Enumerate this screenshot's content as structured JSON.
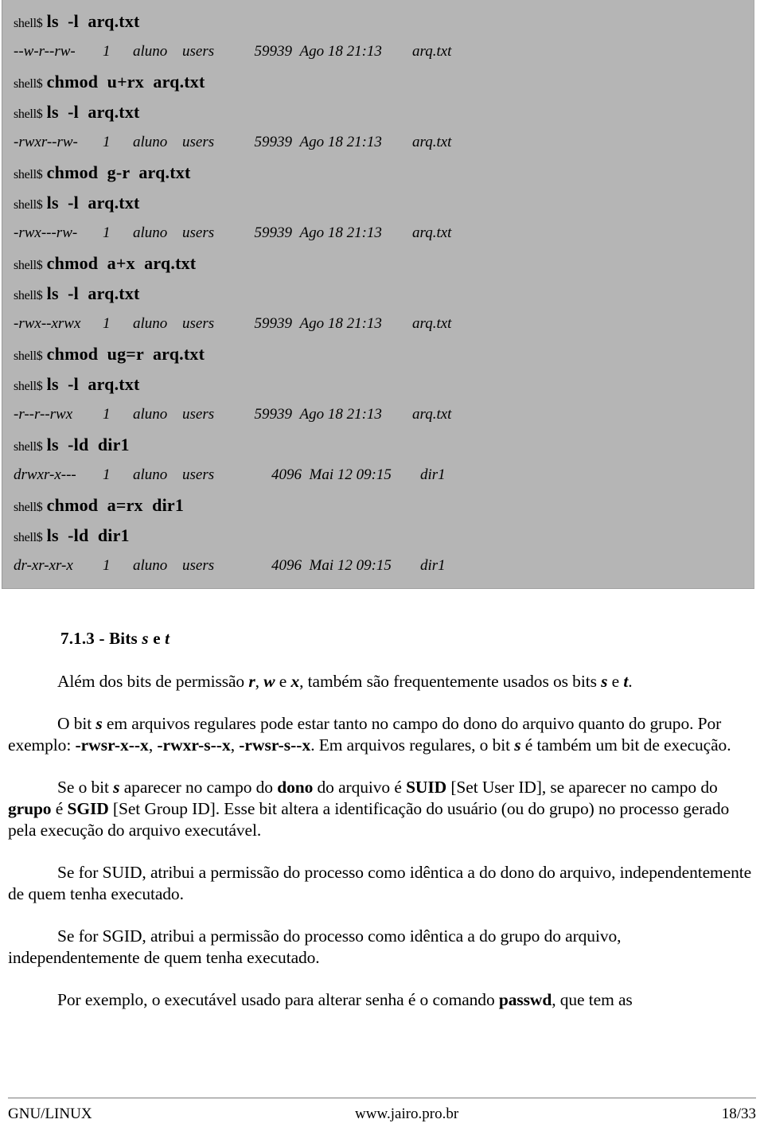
{
  "terminal": {
    "prompt": "shell$",
    "lines": [
      {
        "type": "command",
        "prompt": "shell$",
        "text": "ls  -l  arq.txt"
      },
      {
        "type": "listing",
        "kind": "file",
        "perm": "--w-r--rw-",
        "links": "1",
        "owner": "aluno",
        "group": "users",
        "size": "59939",
        "date": "Ago 18 21:13",
        "name": "arq.txt"
      },
      {
        "type": "command",
        "prompt": "shell$",
        "text": "chmod  u+rx  arq.txt"
      },
      {
        "type": "command",
        "prompt": "shell$",
        "text": "ls  -l  arq.txt"
      },
      {
        "type": "listing",
        "kind": "file",
        "perm": "-rwxr--rw-",
        "links": "1",
        "owner": "aluno",
        "group": "users",
        "size": "59939",
        "date": "Ago 18 21:13",
        "name": "arq.txt"
      },
      {
        "type": "command",
        "prompt": "shell$",
        "text": "chmod  g-r  arq.txt"
      },
      {
        "type": "command",
        "prompt": "shell$",
        "text": "ls  -l  arq.txt"
      },
      {
        "type": "listing",
        "kind": "file",
        "perm": "-rwx---rw-",
        "links": "1",
        "owner": "aluno",
        "group": "users",
        "size": "59939",
        "date": "Ago 18 21:13",
        "name": "arq.txt"
      },
      {
        "type": "command",
        "prompt": "shell$",
        "text": "chmod  a+x  arq.txt"
      },
      {
        "type": "command",
        "prompt": "shell$",
        "text": "ls  -l  arq.txt"
      },
      {
        "type": "listing",
        "kind": "file",
        "perm": "-rwx--xrwx",
        "links": "1",
        "owner": "aluno",
        "group": "users",
        "size": "59939",
        "date": "Ago 18 21:13",
        "name": "arq.txt"
      },
      {
        "type": "command",
        "prompt": "shell$",
        "text": "chmod  ug=r  arq.txt"
      },
      {
        "type": "command",
        "prompt": "shell$",
        "text": "ls  -l  arq.txt"
      },
      {
        "type": "listing",
        "kind": "file",
        "perm": "-r--r--rwx",
        "links": "1",
        "owner": "aluno",
        "group": "users",
        "size": "59939",
        "date": "Ago 18 21:13",
        "name": "arq.txt"
      },
      {
        "type": "command",
        "prompt": "shell$",
        "text": "ls  -ld  dir1"
      },
      {
        "type": "listing",
        "kind": "dir",
        "perm": "drwxr-x---",
        "links": "1",
        "owner": "aluno",
        "group": "users",
        "size": "4096",
        "date": "Mai 12 09:15",
        "name": "dir1"
      },
      {
        "type": "command",
        "prompt": "shell$",
        "text": "chmod  a=rx  dir1"
      },
      {
        "type": "command",
        "prompt": "shell$",
        "text": "ls  -ld  dir1"
      },
      {
        "type": "listing",
        "kind": "dir",
        "perm": "dr-xr-xr-x",
        "links": "1",
        "owner": "aluno",
        "group": "users",
        "size": "4096",
        "date": "Mai 12 09:15",
        "name": "dir1"
      }
    ]
  },
  "section": {
    "heading_number": "7.1.3 - Bits",
    "heading_bit_s": "s",
    "heading_conj": "e",
    "heading_bit_t": "t"
  },
  "paragraphs": {
    "p1": {
      "a": "Além dos bits  de permissão ",
      "r": "r",
      "b": ", ",
      "w": "w",
      "c": " e ",
      "x": "x",
      "d": ",  também são frequentemente usados os bits  ",
      "s": "s",
      "e": "  e  ",
      "t": "t",
      "f": "."
    },
    "p2": {
      "a": "O bit  ",
      "s1": "s",
      "b": "  em arquivos regulares pode estar tanto no campo do dono do arquivo quanto do grupo. Por exemplo:  ",
      "ex1": "-rwsr-x--x",
      "c": ",  ",
      "ex2": "-rwxr-s--x",
      "d": ",  ",
      "ex3": "-rwsr-s--x",
      "e": ".  Em arquivos regulares, o bit  ",
      "s2": "s",
      "f": "  é também um bit de execução."
    },
    "p3": {
      "a": "Se o bit  ",
      "s": "s",
      "b": "  aparecer no campo do ",
      "dono": "dono",
      "c": " do arquivo é ",
      "suid": "SUID",
      "d": " [Set User ID], se aparecer no campo do ",
      "grupo": "grupo",
      "e": " é ",
      "sgid": "SGID",
      "f": " [Set Group ID]. Esse bit altera a identificação do usuário (ou do grupo) no processo gerado pela execução do arquivo executável."
    },
    "p4": "Se for SUID, atribui a permissão do processo como idêntica a do dono do arquivo, independentemente de quem tenha executado.",
    "p5": "Se for SGID, atribui a permissão do processo como idêntica a do grupo do arquivo, independentemente de quem tenha executado.",
    "p6": {
      "a": "Por exemplo, o executável usado para alterar senha é o comando  ",
      "passwd": "passwd",
      "b": ",  que tem as"
    }
  },
  "footer": {
    "left": "GNU/LINUX",
    "center": "www.jairo.pro.br",
    "right": "18/33"
  },
  "colors": {
    "code_background": "#b5b5b5",
    "page_background": "#ffffff",
    "text": "#000000"
  }
}
